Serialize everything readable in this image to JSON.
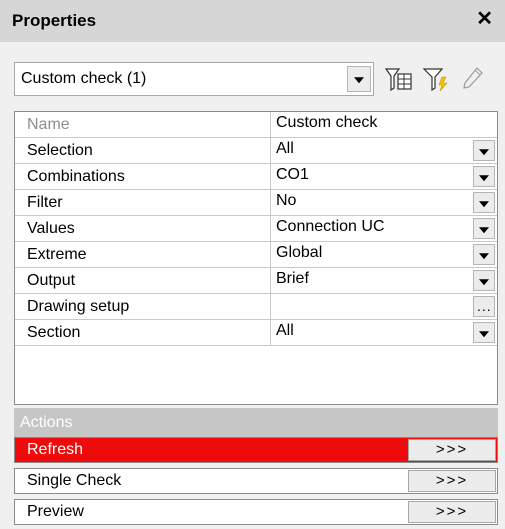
{
  "title": "Properties",
  "close_icon": "close-icon",
  "check_selector": {
    "value": "Custom check (1)"
  },
  "toolbar_icons": [
    "filter-table-icon",
    "filter-lightning-icon",
    "pencil-icon"
  ],
  "properties": [
    {
      "name": "Name",
      "value": "Custom check",
      "control": "none",
      "disabled": true
    },
    {
      "name": "Selection",
      "value": "All",
      "control": "dropdown"
    },
    {
      "name": "Combinations",
      "value": "CO1",
      "control": "dropdown"
    },
    {
      "name": "Filter",
      "value": "No",
      "control": "dropdown"
    },
    {
      "name": "Values",
      "value": "Connection UC",
      "control": "dropdown"
    },
    {
      "name": "Extreme",
      "value": "Global",
      "control": "dropdown"
    },
    {
      "name": "Output",
      "value": "Brief",
      "control": "dropdown"
    },
    {
      "name": "Drawing setup",
      "value": "",
      "control": "ellipsis"
    },
    {
      "name": "Section",
      "value": "All",
      "control": "dropdown"
    }
  ],
  "ellipsis_label": "...",
  "actions_header": "Actions",
  "actions": [
    {
      "label": "Refresh",
      "button": ">>>",
      "highlight_color": "#ee0b0b"
    },
    {
      "label": "Single Check",
      "button": ">>>"
    },
    {
      "label": "Preview",
      "button": ">>>"
    }
  ]
}
